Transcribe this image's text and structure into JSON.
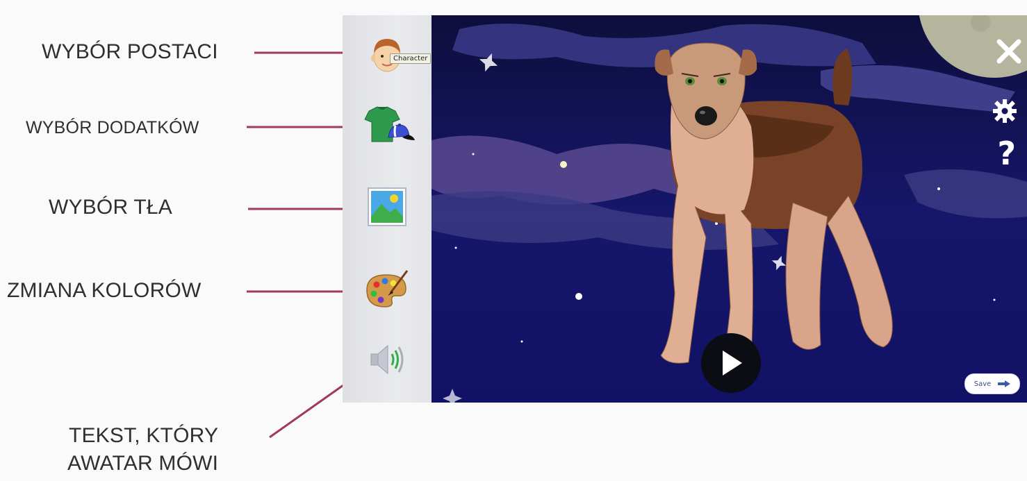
{
  "annotations": {
    "character": "WYBÓR POSTACI",
    "extras": "WYBÓR DODATKÓW",
    "background": "WYBÓR TŁA",
    "colors": "ZMIANA KOLORÓW",
    "speech_line1": "TEKST, KTÓRY",
    "speech_line2": "AWATAR MÓWI"
  },
  "sidebar": {
    "tooltip": "Character",
    "items": [
      {
        "name": "character",
        "icon": "face-icon"
      },
      {
        "name": "accessories",
        "icon": "shirt-cap-icon"
      },
      {
        "name": "background",
        "icon": "landscape-picture-icon"
      },
      {
        "name": "colors",
        "icon": "paint-palette-icon"
      },
      {
        "name": "voice",
        "icon": "speaker-icon"
      }
    ]
  },
  "controls": {
    "close_icon": "close-icon",
    "settings_icon": "gear-icon",
    "help_glyph": "?",
    "play_icon": "play-icon",
    "save_label": "Save"
  },
  "colors": {
    "arrow": "#a0385f",
    "sky": "#12124a",
    "sidebar": "#e6e7ea"
  }
}
